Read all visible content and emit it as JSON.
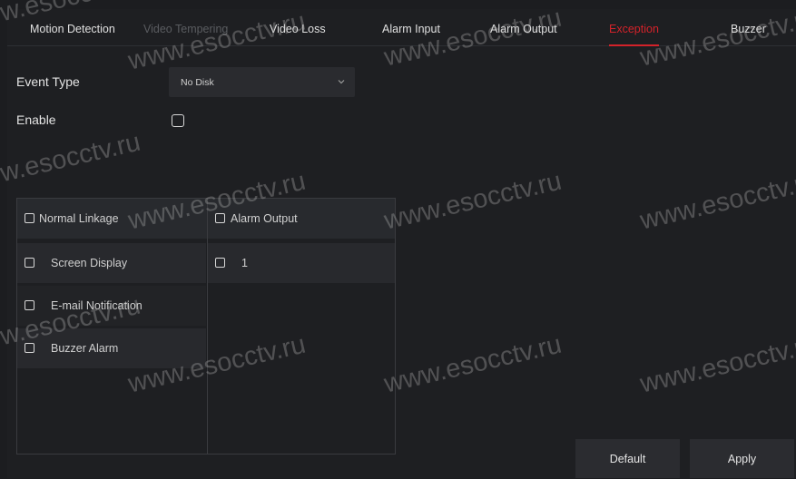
{
  "tabs": [
    {
      "label": "Motion Detection",
      "state": "normal"
    },
    {
      "label": "Video Tempering",
      "state": "disabled"
    },
    {
      "label": "Video Loss",
      "state": "normal"
    },
    {
      "label": "Alarm Input",
      "state": "normal"
    },
    {
      "label": "Alarm Output",
      "state": "normal"
    },
    {
      "label": "Exception",
      "state": "active"
    },
    {
      "label": "Buzzer",
      "state": "normal"
    }
  ],
  "form": {
    "event_type_label": "Event Type",
    "event_type_value": "No Disk",
    "enable_label": "Enable",
    "enable_checked": false
  },
  "linkage": {
    "normal_header": "Normal Linkage",
    "alarm_header": "Alarm Output",
    "normal_items": [
      {
        "label": "Screen Display",
        "checked": false
      },
      {
        "label": "E-mail Notification",
        "checked": false
      },
      {
        "label": "Buzzer Alarm",
        "checked": false
      }
    ],
    "alarm_items": [
      {
        "label": "1",
        "checked": false
      }
    ]
  },
  "buttons": {
    "default_label": "Default",
    "apply_label": "Apply"
  },
  "watermark": "www.esocctv.ru",
  "colors": {
    "accent": "#d4222a",
    "background": "#1e1f22",
    "panel_row": "#28292d",
    "button": "#2b2c30"
  },
  "icons": {
    "dropdown": "chevron-down-icon",
    "checkbox": "checkbox-icon"
  }
}
